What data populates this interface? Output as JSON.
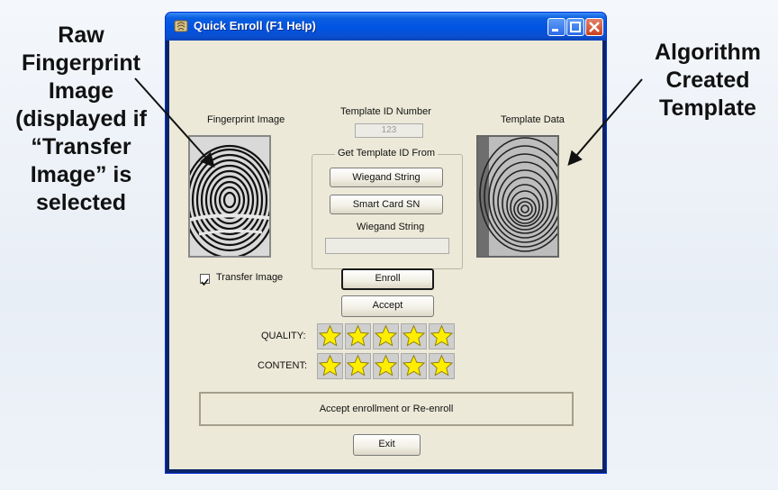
{
  "annotations": {
    "left": "Raw\nFingerprint\nImage\n(displayed if\n“Transfer\nImage” is\nselected",
    "right": "Algorithm\nCreated\nTemplate"
  },
  "window": {
    "title": "Quick Enroll (F1 Help)"
  },
  "fingerprint": {
    "label": "Fingerprint Image"
  },
  "template_data": {
    "label": "Template Data"
  },
  "template_id": {
    "label": "Template ID Number",
    "value": "123"
  },
  "get_template": {
    "title": "Get Template ID From",
    "wiegand_button": "Wiegand String",
    "smartcard_button": "Smart Card SN",
    "wiegand_label": "Wiegand String",
    "wiegand_value": ""
  },
  "transfer_image": {
    "label": "Transfer Image",
    "checked": true
  },
  "buttons": {
    "enroll": "Enroll",
    "accept": "Accept",
    "exit": "Exit"
  },
  "quality": {
    "label": "QUALITY:",
    "stars": 5,
    "max": 5
  },
  "content": {
    "label": "CONTENT:",
    "stars": 5,
    "max": 5
  },
  "status": "Accept enrollment or Re-enroll",
  "colors": {
    "star": "#ffee00",
    "window_bg": "#ece9d8",
    "titlebar": "#0054e3"
  }
}
